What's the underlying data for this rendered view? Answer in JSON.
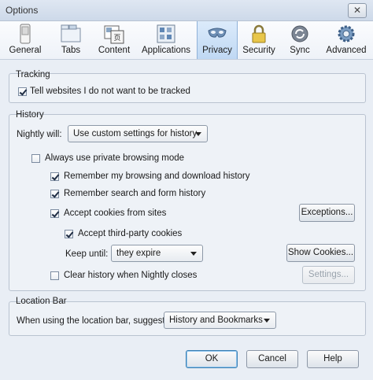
{
  "window": {
    "title": "Options",
    "close_glyph": "✕"
  },
  "toolbar": {
    "items": [
      {
        "label": "General",
        "icon": "general-icon"
      },
      {
        "label": "Tabs",
        "icon": "tabs-icon"
      },
      {
        "label": "Content",
        "icon": "content-icon"
      },
      {
        "label": "Applications",
        "icon": "applications-icon"
      },
      {
        "label": "Privacy",
        "icon": "privacy-mask-icon",
        "selected": true
      },
      {
        "label": "Security",
        "icon": "lock-icon"
      },
      {
        "label": "Sync",
        "icon": "sync-icon"
      },
      {
        "label": "Advanced",
        "icon": "gear-icon"
      }
    ]
  },
  "tracking": {
    "title": "Tracking",
    "dnt": {
      "label": "Tell websites I do not want to be tracked",
      "checked": true
    }
  },
  "history": {
    "title": "History",
    "will_label": "Nightly will:",
    "will_value": "Use custom settings for history",
    "private_mode": {
      "label": "Always use private browsing mode",
      "checked": false
    },
    "remember_browsing": {
      "label": "Remember my browsing and download history",
      "checked": true
    },
    "remember_search": {
      "label": "Remember search and form history",
      "checked": true
    },
    "accept_cookies": {
      "label": "Accept cookies from sites",
      "checked": true
    },
    "exceptions_button": "Exceptions...",
    "third_party": {
      "label": "Accept third-party cookies",
      "checked": true
    },
    "keep_until_label": "Keep until:",
    "keep_until_value": "they expire",
    "show_cookies_button": "Show Cookies...",
    "clear_on_close": {
      "label": "Clear history when Nightly closes",
      "checked": false
    },
    "settings_button": "Settings..."
  },
  "location_bar": {
    "title": "Location Bar",
    "suggest_label": "When using the location bar, suggest:",
    "suggest_value": "History and Bookmarks"
  },
  "footer": {
    "ok": "OK",
    "cancel": "Cancel",
    "help": "Help"
  },
  "colors": {
    "selected_tab": "#c9def5",
    "window_bg": "#e9eef5"
  }
}
